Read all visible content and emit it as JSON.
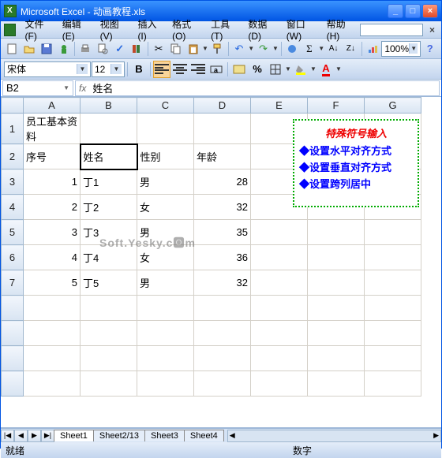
{
  "window": {
    "title": "Microsoft Excel - 动画教程.xls"
  },
  "menu": {
    "file": "文件(F)",
    "edit": "编辑(E)",
    "view": "视图(V)",
    "insert": "插入(I)",
    "format": "格式(O)",
    "tools": "工具(T)",
    "data": "数据(D)",
    "window": "窗口(W)",
    "help": "帮助(H)"
  },
  "toolbar": {
    "zoom": "100%"
  },
  "font": {
    "name": "宋体",
    "size": "12"
  },
  "formula": {
    "cellref": "B2",
    "fx": "fx",
    "value": "姓名"
  },
  "cols": [
    "A",
    "B",
    "C",
    "D",
    "E",
    "F",
    "G"
  ],
  "rows": [
    "1",
    "2",
    "3",
    "4",
    "5",
    "6",
    "7"
  ],
  "cells": {
    "A1": "员工基本资料",
    "A2": "序号",
    "B2": "姓名",
    "C2": "性别",
    "D2": "年龄",
    "A3": "1",
    "B3": "丁1",
    "C3": "男",
    "D3": "28",
    "A4": "2",
    "B4": "丁2",
    "C4": "女",
    "D4": "32",
    "A5": "3",
    "B5": "丁3",
    "C5": "男",
    "D5": "35",
    "A6": "4",
    "B6": "丁4",
    "C6": "女",
    "D6": "36",
    "A7": "5",
    "B7": "丁5",
    "C7": "男",
    "D7": "32"
  },
  "note": {
    "title": "特殊符号输入",
    "i1": "◆设置水平对齐方式",
    "i2": "◆设置垂直对齐方式",
    "i3": "◆设置跨列居中"
  },
  "sheets": {
    "s1": "Sheet1",
    "s2": "Sheet2/13",
    "s3": "Sheet3",
    "s4": "Sheet4"
  },
  "status": {
    "ready": "就绪",
    "mode": "数字"
  },
  "watermark": "Soft.Yesky.c🅾m"
}
